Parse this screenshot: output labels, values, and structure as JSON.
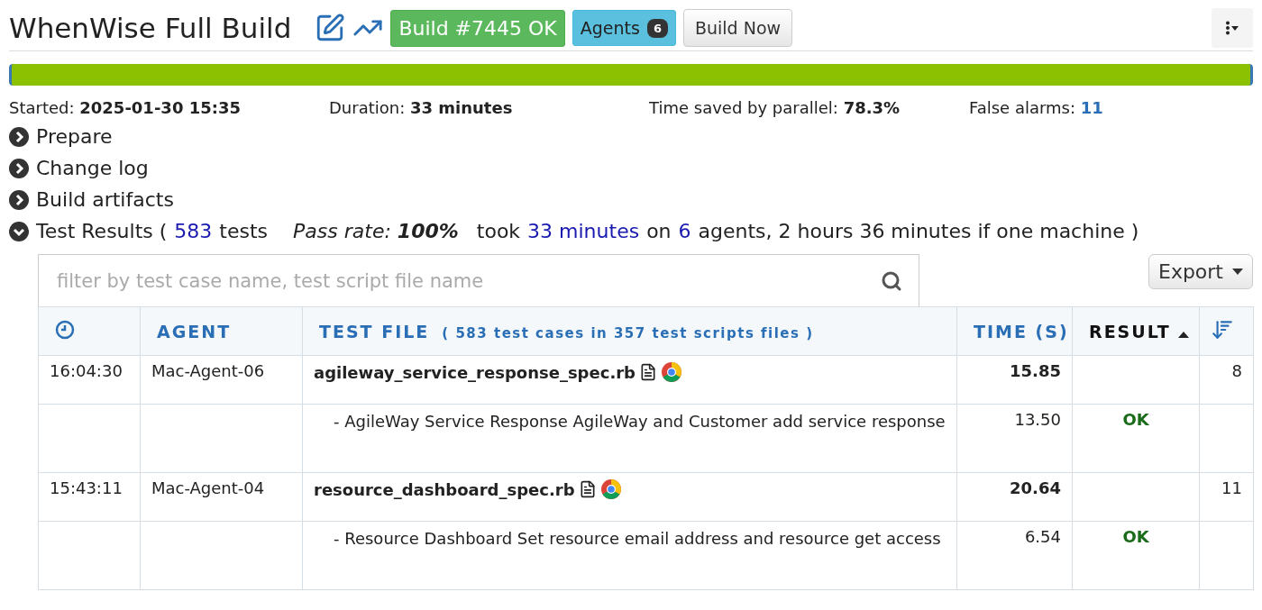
{
  "title": "WhenWise Full Build",
  "build_badge": "Build #7445 OK",
  "agents": {
    "label": "Agents",
    "count": "6"
  },
  "build_now": "Build Now",
  "progress": {
    "level": 1
  },
  "stats": [
    {
      "label": "Started:",
      "value": "2025-01-30 15:35",
      "kind": "bold"
    },
    {
      "label": "Duration:",
      "value": "33 minutes",
      "kind": "bold"
    },
    {
      "label": "Time saved by parallel:",
      "value": "78.3%",
      "kind": "bold"
    },
    {
      "label": "False alarms:",
      "value": "11",
      "kind": "link"
    }
  ],
  "sections": [
    {
      "label": "Prepare",
      "expanded": false
    },
    {
      "label": "Change log",
      "expanded": false
    },
    {
      "label": "Build artifacts",
      "expanded": false
    },
    {
      "label": "Test Results (",
      "expanded": true,
      "summary": [
        {
          "text": "583",
          "kind": "link"
        },
        {
          "text": "tests",
          "kind": "plain"
        },
        {
          "text": "Pass rate: **100%**",
          "kind": "italic"
        },
        {
          "text": "took",
          "kind": "plain"
        },
        {
          "text": "33 minutes",
          "kind": "link"
        },
        {
          "text": "on",
          "kind": "plain"
        },
        {
          "text": "6",
          "kind": "link"
        },
        {
          "text": "agents, 2 hours 36 minutes if one machine )",
          "kind": "plain"
        }
      ]
    }
  ],
  "filter": {
    "placeholder": "filter by test case name, test script file name"
  },
  "export": "Export",
  "columns": [
    {
      "kind": "clock"
    },
    {
      "kind": "text",
      "label": "AGENT"
    },
    {
      "kind": "text",
      "label": "TEST FILE",
      "note": "( 583 test cases in 357 test scripts files )"
    },
    {
      "kind": "text",
      "label": "TIME (S)"
    },
    {
      "kind": "sorted",
      "label": "RESULT"
    },
    {
      "kind": "sort-icon"
    }
  ],
  "rows": [
    {
      "kind": "file",
      "time": "16:04:30",
      "agent": "Mac-Agent-06",
      "file": "agileway_service_response_spec.rb",
      "seconds": "15.85",
      "count": "8"
    },
    {
      "kind": "case",
      "title": "- AgileWay Service Response AgileWay and Customer add service response",
      "seconds": "13.50",
      "result": "OK"
    },
    {
      "kind": "file",
      "time": "15:43:11",
      "agent": "Mac-Agent-04",
      "file": "resource_dashboard_spec.rb",
      "seconds": "20.64",
      "count": "11"
    },
    {
      "kind": "case",
      "title": "- Resource Dashboard Set resource email address and resource get access",
      "seconds": "6.54",
      "result": "OK"
    }
  ]
}
